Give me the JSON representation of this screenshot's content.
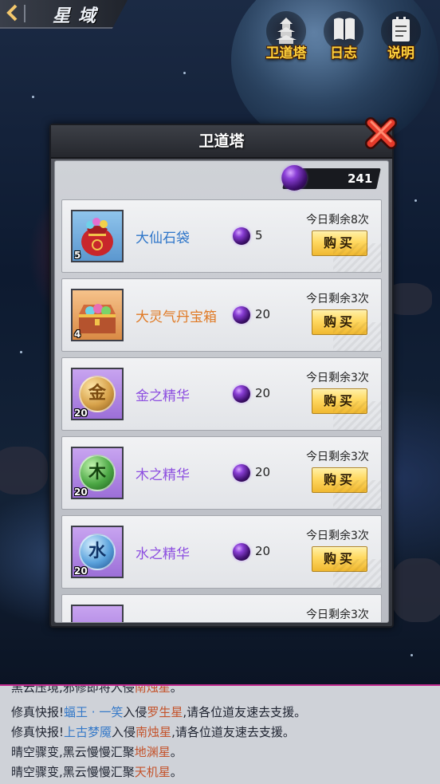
{
  "header": {
    "back_icon": "chevron-left-icon",
    "title": "星域"
  },
  "menu": [
    {
      "label": "卫道塔",
      "icon": "pagoda-icon"
    },
    {
      "label": "日志",
      "icon": "book-icon"
    },
    {
      "label": "说明",
      "icon": "notepad-icon"
    }
  ],
  "modal": {
    "title": "卫道塔",
    "close_icon": "close-icon",
    "currency": {
      "icon": "purple-orb-icon",
      "value": "241"
    },
    "items": [
      {
        "name": "大仙石袋",
        "count": "5",
        "price": "5",
        "remaining": "今日剩余8次",
        "buy": "购买",
        "name_color": "#2f76c9",
        "icon": "treasure-bag-icon"
      },
      {
        "name": "大灵气丹宝箱",
        "count": "4",
        "price": "20",
        "remaining": "今日剩余3次",
        "buy": "购买",
        "name_color": "#e07a25",
        "icon": "treasure-chest-icon"
      },
      {
        "name": "金之精华",
        "count": "20",
        "price": "20",
        "remaining": "今日剩余3次",
        "buy": "购买",
        "name_color": "#8d4fe0",
        "icon": "metal-essence-icon",
        "glyph": "金"
      },
      {
        "name": "木之精华",
        "count": "20",
        "price": "20",
        "remaining": "今日剩余3次",
        "buy": "购买",
        "name_color": "#8d4fe0",
        "icon": "wood-essence-icon",
        "glyph": "木"
      },
      {
        "name": "水之精华",
        "count": "20",
        "price": "20",
        "remaining": "今日剩余3次",
        "buy": "购买",
        "name_color": "#8d4fe0",
        "icon": "water-essence-icon",
        "glyph": "水"
      },
      {
        "remaining": "今日剩余3次"
      }
    ]
  },
  "log": {
    "lines": [
      {
        "pre": "黑云压境,邪修即将入侵",
        "hl": "南烛星",
        "post": "。"
      },
      {
        "pre": "修真快报!",
        "hl1": "蝠王 · 一笑",
        "mid": "入侵",
        "hl2": "罗生星",
        "post": ",请各位道友速去支援。"
      },
      {
        "pre": "修真快报!",
        "hl1": "上古梦魇",
        "mid": "入侵",
        "hl2": "南烛星",
        "post": ",请各位道友速去支援。"
      },
      {
        "pre": "晴空骤变,黑云慢慢汇聚",
        "hl": "地渊星",
        "post": "。"
      },
      {
        "pre": "晴空骤变,黑云慢慢汇聚",
        "hl": "天机星",
        "post": "。"
      }
    ]
  }
}
